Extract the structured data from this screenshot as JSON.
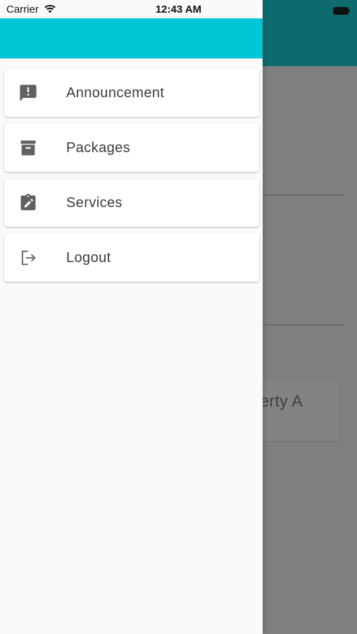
{
  "status_bar": {
    "carrier": "Carrier",
    "time": "12:43 AM",
    "wifi_icon": "wifi-icon",
    "battery_icon": "battery-icon"
  },
  "drawer": {
    "header_color": "#00c7d5",
    "items": [
      {
        "label": "Announcement",
        "icon": "announcement-icon"
      },
      {
        "label": "Packages",
        "icon": "archive-icon"
      },
      {
        "label": "Services",
        "icon": "assignment-icon"
      },
      {
        "label": "Logout",
        "icon": "logout-icon"
      }
    ]
  },
  "background": {
    "appbar_color": "#0d6a6d",
    "card_text": "erty A"
  }
}
